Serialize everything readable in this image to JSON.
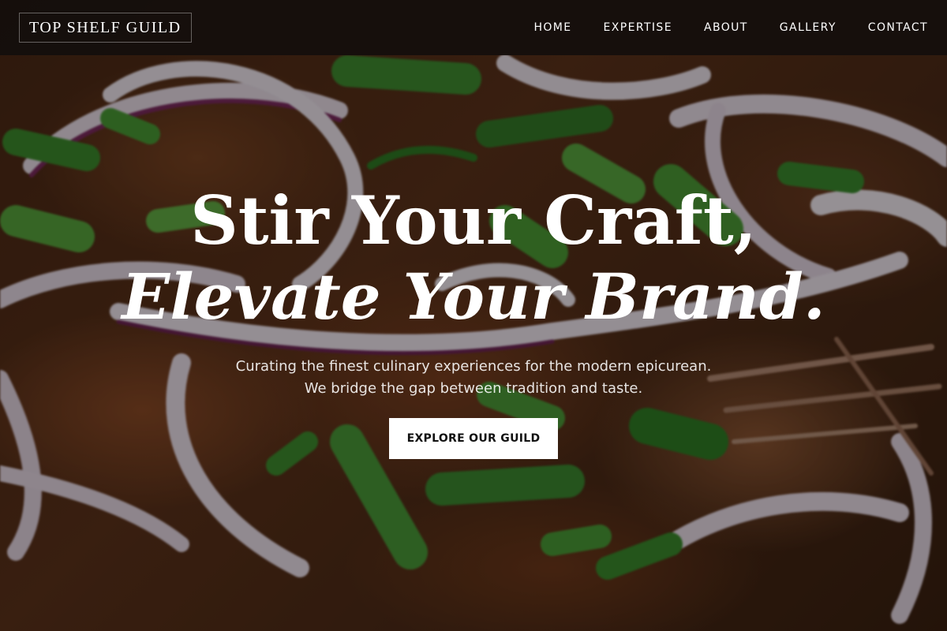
{
  "brand": {
    "logo_text": "TOP SHELF GUILD"
  },
  "nav": {
    "items": [
      {
        "label": "HOME"
      },
      {
        "label": "EXPERTISE"
      },
      {
        "label": "ABOUT"
      },
      {
        "label": "GALLERY"
      },
      {
        "label": "CONTACT"
      }
    ]
  },
  "hero": {
    "headline_line1": "Stir Your Craft,",
    "headline_line2": "Elevate Your Brand.",
    "subtitle_line1": "Curating the finest culinary experiences for the modern epicurean.",
    "subtitle_line2": "We bridge the gap between tradition and taste.",
    "cta_label": "EXPLORE OUR GUILD",
    "background_image": "food-dish-photo"
  },
  "colors": {
    "nav_bg": "#140e0c",
    "text": "#ffffff",
    "cta_bg": "#ffffff",
    "cta_text": "#111111"
  }
}
